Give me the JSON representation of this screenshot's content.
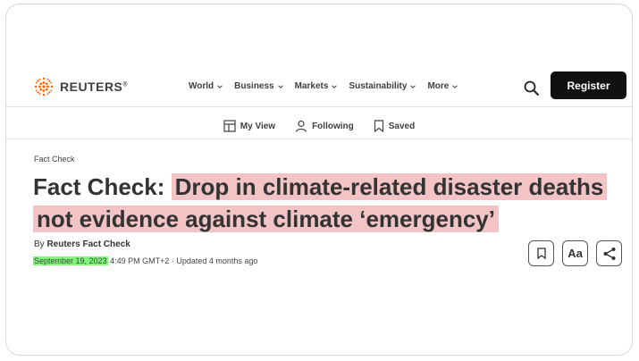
{
  "header": {
    "logo_text": "REUTERS",
    "logo_reg": "®",
    "menu": [
      {
        "label": "World"
      },
      {
        "label": "Business"
      },
      {
        "label": "Markets"
      },
      {
        "label": "Sustainability"
      },
      {
        "label": "More"
      }
    ],
    "register_label": "Register",
    "brand_color": "#fa6400"
  },
  "subnav": {
    "my_view": "My View",
    "following": "Following",
    "saved": "Saved"
  },
  "article": {
    "kicker": "Fact Check",
    "headline_prefix": "Fact Check: ",
    "headline_highlight_1": "Drop in climate-related disaster deaths",
    "headline_highlight_2": "not evidence against climate ‘emergency’",
    "byline_prefix": "By ",
    "byline_author": "Reuters Fact Check",
    "date": "September 19, 2023",
    "time_updated": " 4:49 PM GMT+2 · Updated 4 months ago",
    "highlight_color": "#f2c4c6",
    "date_highlight_color": "#7df67a",
    "font_size_button": "Aa"
  }
}
